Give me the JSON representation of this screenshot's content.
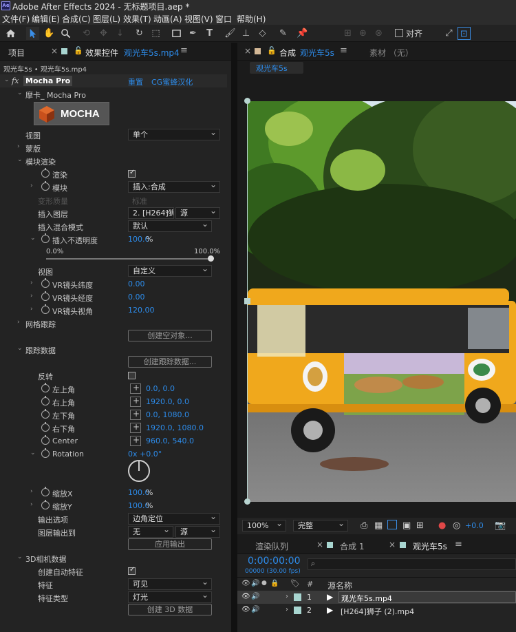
{
  "app": {
    "title": "Adobe After Effects 2024 - 无标题项目.aep *",
    "logo_text": "Ae"
  },
  "menu": [
    "文件(F)",
    "编辑(E)",
    "合成(C)",
    "图层(L)",
    "效果(T)",
    "动画(A)",
    "视图(V)",
    "窗口",
    "帮助(H)"
  ],
  "toolbar": {
    "align_label": "对齐"
  },
  "left_panel": {
    "tab_project": "项目",
    "tab_effects_prefix": "效果控件",
    "tab_effects_file": "观光车5s.mp4",
    "breadcrumb": "观光车5s • 观光车5s.mp4",
    "fx_label": "fx",
    "effect_name": "Mocha Pro",
    "reset": "重置",
    "cg_link": "CG蜜蜂汉化",
    "mocha_sub": "摩卡_ Mocha Pro",
    "mocha_logo": "MOCHA",
    "view_label": "视图",
    "view_value": "单个",
    "matte_label": "蒙版",
    "module_render": "模块渲染",
    "render_label": "渲染",
    "module_label": "模块",
    "module_value": "插入:合成",
    "warp_quality": "变形质量",
    "warp_value": "标准",
    "insert_layer": "插入图层",
    "insert_layer_value": "2. [H264]狮",
    "insert_layer_source": "源",
    "insert_blend": "插入混合模式",
    "insert_blend_value": "默认",
    "insert_opacity": "插入不透明度",
    "insert_opacity_value": "100.0",
    "insert_opacity_unit": "%",
    "slider_min": "0.0%",
    "slider_max": "100.0%",
    "slider_fraction": 1.0,
    "view2_label": "视图",
    "view2_value": "自定义",
    "vr_lat": "VR镜头纬度",
    "vr_lat_value": "0.00",
    "vr_lon": "VR镜头经度",
    "vr_lon_value": "0.00",
    "vr_fov": "VR镜头视角",
    "vr_fov_value": "120.00",
    "mesh_track": "网格跟踪",
    "create_null": "创建空对象...",
    "track_data": "跟踪数据",
    "create_track": "创建跟踪数据...",
    "invert": "反转",
    "top_left": "左上角",
    "top_left_value": "0.0, 0.0",
    "top_right": "右上角",
    "top_right_value": "1920.0, 0.0",
    "bottom_left": "左下角",
    "bottom_left_value": "0.0, 1080.0",
    "bottom_right": "右下角",
    "bottom_right_value": "1920.0, 1080.0",
    "center": "Center",
    "center_value": "960.0, 540.0",
    "rotation": "Rotation",
    "rotation_value": "0x +0.0°",
    "scale_x": "缩放X",
    "scale_x_value": "100.0",
    "scale_x_unit": "%",
    "scale_y": "缩放Y",
    "scale_y_value": "100.0",
    "scale_y_unit": "%",
    "output_option": "输出选项",
    "output_option_value": "边角定位",
    "layer_output": "图层输出到",
    "layer_output_value": "无",
    "layer_output_source": "源",
    "apply_output": "应用输出",
    "camera_data": "3D相机数据",
    "auto_feature": "创建自动特征",
    "feature": "特征",
    "feature_value": "可见",
    "feature_type": "特征类型",
    "feature_type_value": "灯光",
    "create_3d": "创建 3D 数据"
  },
  "right_panel": {
    "tab_comp": "合成",
    "tab_comp_name": "观光车5s",
    "tab_material": "素材 （无）",
    "comp_chip": "观光车5s",
    "zoom": "100%",
    "quality": "完整",
    "exposure": "+0.0"
  },
  "timeline": {
    "tab_render": "渲染队列",
    "tab_comp1": "合成 1",
    "tab_active": "观光车5s",
    "timecode": "0:00:00:00",
    "frames": "00000 (30.00 fps)",
    "col_num": "#",
    "col_name": "源名称",
    "layers": [
      {
        "num": "1",
        "name": "观光车5s.mp4"
      },
      {
        "num": "2",
        "name": "[H264]狮子 (2).mp4"
      }
    ]
  },
  "colors": {
    "accent": "#2d8ceb",
    "panel": "#232323",
    "bg": "#1b1b1b",
    "bus": "#f0a81c"
  }
}
